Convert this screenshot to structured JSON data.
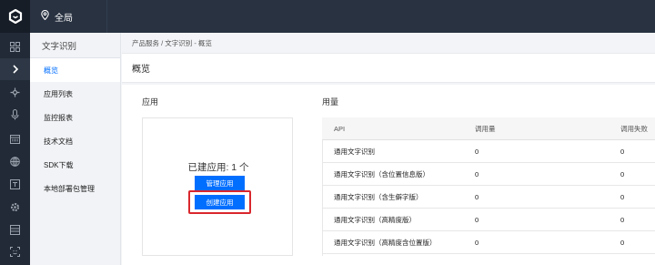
{
  "topbar": {
    "region": "全局"
  },
  "rail_icons": [
    "grid-icon",
    "chevron-right-icon",
    "puzzle-icon",
    "microphone-icon",
    "calendar-icon",
    "globe-icon",
    "terminal-icon",
    "gear-icon",
    "archive-icon",
    "scan-face-icon"
  ],
  "sidebar": {
    "title": "文字识别",
    "items": [
      {
        "label": "概览",
        "active": true
      },
      {
        "label": "应用列表"
      },
      {
        "label": "监控报表"
      },
      {
        "label": "技术文档"
      },
      {
        "label": "SDK下载"
      },
      {
        "label": "本地部署包管理"
      }
    ]
  },
  "breadcrumb": "产品服务 / 文字识别 - 概览",
  "page_title": "概览",
  "apps": {
    "section_title": "应用",
    "count_text": "已建应用: 1 个",
    "manage_button": "管理应用",
    "create_button": "创建应用"
  },
  "usage": {
    "section_title": "用量",
    "columns": [
      "API",
      "调用量",
      "调用失败"
    ],
    "rows": [
      [
        "通用文字识别",
        "0",
        "0"
      ],
      [
        "通用文字识别（含位置信息版）",
        "0",
        "0"
      ],
      [
        "通用文字识别（含生僻字版）",
        "0",
        "0"
      ],
      [
        "通用文字识别（高精度版）",
        "0",
        "0"
      ],
      [
        "通用文字识别（高精度含位置版）",
        "0",
        "0"
      ]
    ]
  },
  "colors": {
    "accent": "#006eff",
    "highlight": "#d9272e",
    "rail": "#212a36",
    "topbar": "#283241"
  }
}
